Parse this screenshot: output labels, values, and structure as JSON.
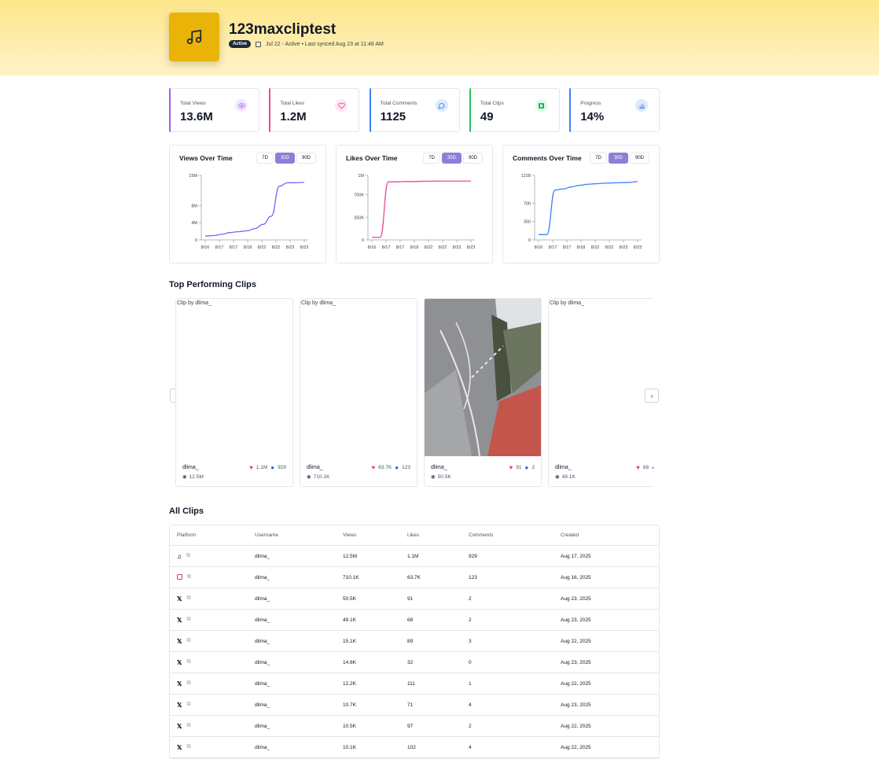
{
  "header": {
    "title": "123maxcliptest",
    "status_badge": "Active",
    "meta": "Jul 22 - Active • Last synced Aug 23 at 11:48 AM"
  },
  "stats": [
    {
      "label": "Total Views",
      "value": "13.6M",
      "color": "#a855f7",
      "icon": "eye-icon"
    },
    {
      "label": "Total Likes",
      "value": "1.2M",
      "color": "#ec4899",
      "icon": "heart-icon"
    },
    {
      "label": "Total Comments",
      "value": "1125",
      "color": "#3b82f6",
      "icon": "comment-icon"
    },
    {
      "label": "Total Clips",
      "value": "49",
      "color": "#22c55e",
      "icon": "film-icon"
    },
    {
      "label": "Progress",
      "value": "14%",
      "color": "#3b82f6",
      "icon": "bar-chart-icon"
    }
  ],
  "range_options": [
    "7D",
    "30D",
    "90D"
  ],
  "range_selected": "30D",
  "chart_data": [
    {
      "type": "line",
      "title": "Views Over Time",
      "color": "#8b5cf6",
      "x": [
        "8/16",
        "8/17",
        "8/17",
        "8/18",
        "8/22",
        "8/22",
        "8/23",
        "8/23"
      ],
      "yticks": [
        "0",
        "4M",
        "8M",
        "15M"
      ],
      "ytick_values": [
        0,
        4000000,
        8000000,
        15000000
      ],
      "ylim": [
        0,
        15000000
      ],
      "values": [
        900000,
        1000000,
        1300000,
        1700000,
        1900000,
        2100000,
        2600000,
        3600000,
        5500000,
        12500000,
        13300000,
        13300000,
        13400000
      ]
    },
    {
      "type": "line",
      "title": "Likes Over Time",
      "color": "#ec4899",
      "x": [
        "8/16",
        "8/17",
        "8/17",
        "8/18",
        "8/22",
        "8/22",
        "8/23",
        "8/23"
      ],
      "yticks": [
        "0",
        "350K",
        "700K",
        "1M"
      ],
      "ytick_values": [
        0,
        350000,
        700000,
        1000000
      ],
      "ylim": [
        0,
        1000000
      ],
      "values": [
        40000,
        40000,
        900000,
        900000,
        905000,
        905000,
        908000,
        910000,
        912000,
        912000,
        912000,
        912000,
        912000
      ]
    },
    {
      "type": "line",
      "title": "Comments Over Time",
      "color": "#3b82f6",
      "x": [
        "8/16",
        "8/17",
        "8/17",
        "8/18",
        "8/22",
        "8/22",
        "8/23",
        "8/23"
      ],
      "yticks": [
        "0",
        "350",
        "700",
        "1228"
      ],
      "ytick_values": [
        0,
        350,
        700,
        1228
      ],
      "ylim": [
        0,
        1228
      ],
      "values": [
        100,
        100,
        950,
        970,
        1010,
        1040,
        1060,
        1070,
        1080,
        1085,
        1090,
        1095,
        1110
      ]
    }
  ],
  "top_clips": {
    "title": "Top Performing Clips",
    "items": [
      {
        "alt": "Clip by dlima_",
        "username": "dlima_",
        "likes": "1.1M",
        "comments": "929",
        "views": "12.5M",
        "image": "blank"
      },
      {
        "alt": "Clip by dlima_",
        "username": "dlima_",
        "likes": "63.7K",
        "comments": "123",
        "views": "710.1K",
        "image": "blank"
      },
      {
        "alt": "",
        "username": "dlima_",
        "likes": "91",
        "comments": "2",
        "views": "50.5K",
        "image": "street-photo"
      },
      {
        "alt": "Clip by dlima_",
        "username": "dlima_",
        "likes": "68",
        "comments": "",
        "views": "49.1K",
        "image": "blank"
      }
    ]
  },
  "all_clips": {
    "title": "All Clips",
    "columns": [
      "Platform",
      "Username",
      "Views",
      "Likes",
      "Comments",
      "Created"
    ],
    "rows": [
      {
        "platform": "tiktok",
        "username": "dlima_",
        "views": "12.5M",
        "likes": "1.1M",
        "comments": "929",
        "created": "Aug 17, 2025"
      },
      {
        "platform": "instagram",
        "username": "dlima_",
        "views": "710.1K",
        "likes": "63.7K",
        "comments": "123",
        "created": "Aug 16, 2025"
      },
      {
        "platform": "x",
        "username": "dlima_",
        "views": "50.5K",
        "likes": "91",
        "comments": "2",
        "created": "Aug 23, 2025"
      },
      {
        "platform": "x",
        "username": "dlima_",
        "views": "49.1K",
        "likes": "68",
        "comments": "2",
        "created": "Aug 23, 2025"
      },
      {
        "platform": "x",
        "username": "dlima_",
        "views": "15.1K",
        "likes": "89",
        "comments": "3",
        "created": "Aug 22, 2025"
      },
      {
        "platform": "x",
        "username": "dlima_",
        "views": "14.6K",
        "likes": "32",
        "comments": "0",
        "created": "Aug 23, 2025"
      },
      {
        "platform": "x",
        "username": "dlima_",
        "views": "12.2K",
        "likes": "111",
        "comments": "1",
        "created": "Aug 22, 2025"
      },
      {
        "platform": "x",
        "username": "dlima_",
        "views": "10.7K",
        "likes": "71",
        "comments": "4",
        "created": "Aug 23, 2025"
      },
      {
        "platform": "x",
        "username": "dlima_",
        "views": "10.5K",
        "likes": "97",
        "comments": "2",
        "created": "Aug 22, 2025"
      },
      {
        "platform": "x",
        "username": "dlima_",
        "views": "10.1K",
        "likes": "102",
        "comments": "4",
        "created": "Aug 22, 2025"
      }
    ]
  }
}
